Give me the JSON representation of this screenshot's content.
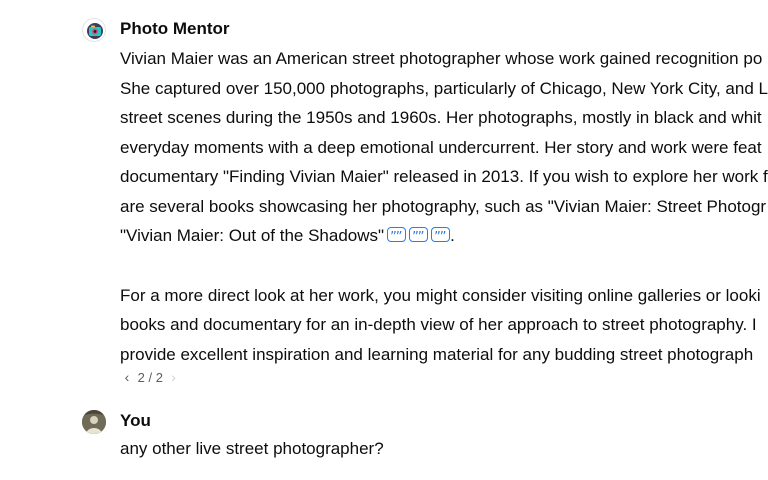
{
  "assistant": {
    "name": "Photo Mentor",
    "lines_p1": [
      "Vivian Maier was an American street photographer whose work gained recognition po",
      "She captured over 150,000 photographs, particularly of Chicago, New York City, and L",
      "street scenes during the 1950s and 1960s. Her photographs, mostly in black and whit",
      "everyday moments with a deep emotional undercurrent. Her story and work were feat",
      "documentary \"Finding Vivian Maier\" released in 2013. If you wish to explore her work f",
      "are several books showcasing her photography, such as \"Vivian Maier: Street Photogr",
      "\"Vivian Maier: Out of the Shadows\""
    ],
    "line_end": ".",
    "lines_p2": [
      "For a more direct look at her work, you might consider visiting online galleries or looki",
      "books and documentary for an in-depth view of her approach to street photography. I",
      "provide excellent inspiration and learning material for any budding street photograph"
    ],
    "pager": {
      "prev": "‹",
      "label": "2 / 2",
      "next": "›"
    }
  },
  "user": {
    "name": "You",
    "text": "any other live street photographer?"
  },
  "colors": {
    "citation": "#2f7de1",
    "text": "#0d0d0d",
    "muted": "#5d5d5d"
  },
  "icons": {
    "assistant_avatar": "photo-mentor-avatar",
    "user_avatar": "user-avatar",
    "citation": "quote-citation-icon"
  }
}
